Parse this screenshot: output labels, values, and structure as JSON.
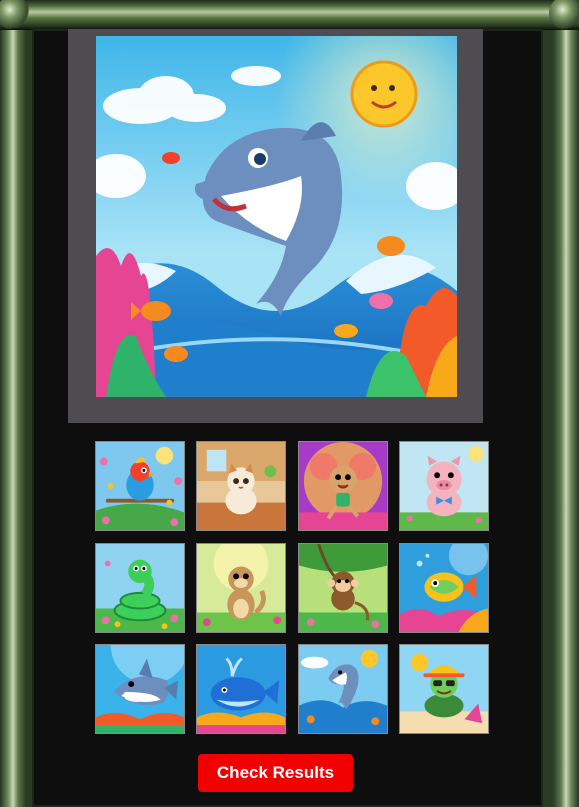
{
  "game": {
    "main_image": {
      "icon": "dolphin-jumping-ocean-scene"
    },
    "thumbnails": [
      {
        "icon": "parrot-on-branch"
      },
      {
        "icon": "kitten-in-room"
      },
      {
        "icon": "dancing-mouse"
      },
      {
        "icon": "pig-with-bow"
      },
      {
        "icon": "green-snake"
      },
      {
        "icon": "meerkat"
      },
      {
        "icon": "monkey-on-vine"
      },
      {
        "icon": "colorful-fish"
      },
      {
        "icon": "shark"
      },
      {
        "icon": "blue-whale"
      },
      {
        "icon": "dolphin"
      },
      {
        "icon": "turtle-with-hat"
      }
    ],
    "check_button_label": "Check Results"
  },
  "colors": {
    "frame": "#2b3a24",
    "board_bg": "#0e0e0e",
    "main_panel": "#4e4c51",
    "button": "#f20000"
  }
}
